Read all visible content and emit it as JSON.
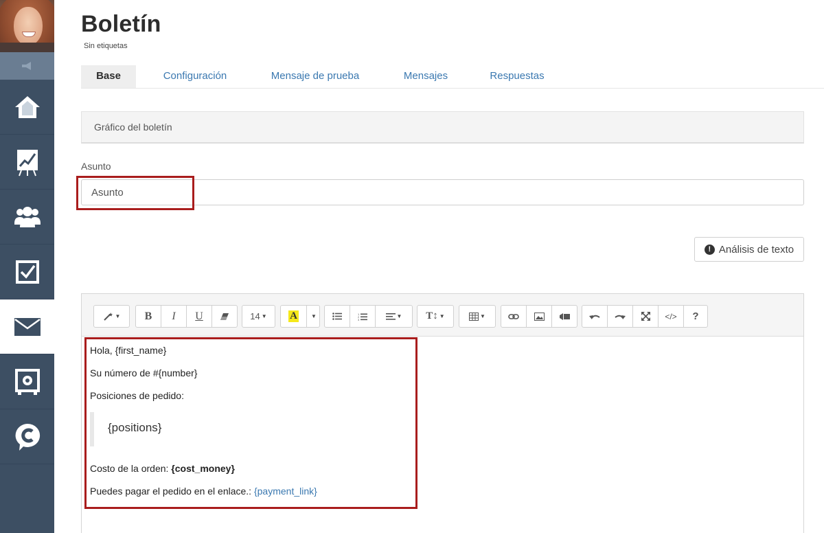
{
  "sidebar": {
    "items": [
      {
        "name": "home",
        "icon": "home-icon"
      },
      {
        "name": "analytics",
        "icon": "chart-board-icon"
      },
      {
        "name": "users",
        "icon": "users-group-icon"
      },
      {
        "name": "tasks",
        "icon": "checkbox-icon"
      },
      {
        "name": "newsletter",
        "icon": "envelope-icon",
        "active": true
      },
      {
        "name": "safe",
        "icon": "safe-icon"
      },
      {
        "name": "chat",
        "icon": "chat-c-icon"
      }
    ]
  },
  "page": {
    "title": "Boletín",
    "tags": "Sin etiquetas"
  },
  "tabs": [
    {
      "label": "Base",
      "active": true
    },
    {
      "label": "Configuración"
    },
    {
      "label": "Mensaje de prueba"
    },
    {
      "label": "Mensajes"
    },
    {
      "label": "Respuestas"
    }
  ],
  "panel": {
    "title": "Gráfico del boletín"
  },
  "subject": {
    "label": "Asunto",
    "placeholder": "Asunto",
    "value": ""
  },
  "analysis_button": {
    "label": "Análisis de texto"
  },
  "toolbar": {
    "font_size": "14"
  },
  "editor": {
    "line1": "Hola, {first_name}",
    "line2": "Su número de #{number}",
    "line3": "Posiciones de pedido:",
    "positions": "{positions}",
    "cost_prefix": "Costo de la orden: ",
    "cost_value": "{cost_money}",
    "pay_prefix": "Puedes pagar el pedido en el enlace.: ",
    "pay_link": "{payment_link}"
  },
  "colors": {
    "sidebar": "#3d4f63",
    "link": "#3a78b0",
    "highlight": "#a91d1d"
  }
}
